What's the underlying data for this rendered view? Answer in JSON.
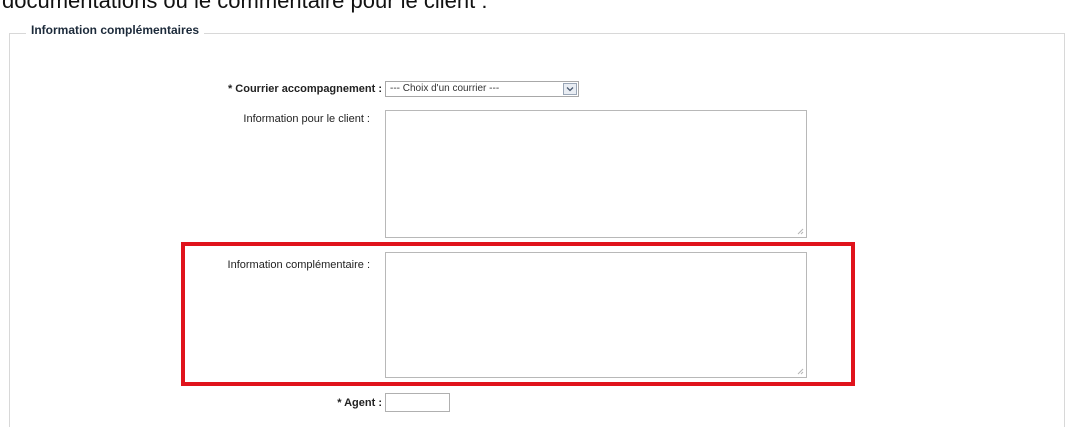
{
  "page": {
    "intro_text": "documentations ou le commentaire pour le client :"
  },
  "section": {
    "title": "Information complémentaires"
  },
  "form": {
    "courrier": {
      "label": "* Courrier accompagnement :",
      "selected": "--- Choix d'un courrier ---"
    },
    "info_client": {
      "label": "Information pour le client :",
      "value": ""
    },
    "info_complementaire": {
      "label": "Information complémentaire :",
      "value": ""
    },
    "agent": {
      "label": "* Agent :",
      "value": ""
    }
  },
  "colors": {
    "highlight": "#e0131c",
    "legend_text": "#1c2a3a"
  },
  "icons": {
    "dropdown": "chevron-down-icon",
    "resize": "resize-grip-icon"
  }
}
